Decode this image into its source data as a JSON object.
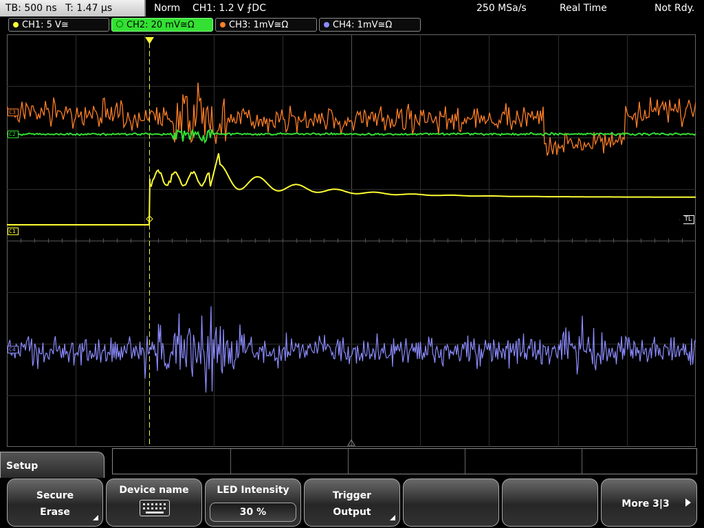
{
  "status": {
    "timebase": "TB: 500 ns",
    "trigger_time": "T: 1.47 µs",
    "mode": "Norm",
    "trigger_source": "CH1: 1.2 V ⨍DC",
    "sample_rate": "250 MSa/s",
    "acq_mode": "Real Time",
    "state": "Not Rdy."
  },
  "channels": [
    {
      "label": "CH1: 5 V≅",
      "color": "#ffff33"
    },
    {
      "label": "CH2: 20 mV≅Ω",
      "color": "#33e033"
    },
    {
      "label": "CH3: 1mV≅Ω",
      "color": "#ff7f27"
    },
    {
      "label": "CH4: 1mV≅Ω",
      "color": "#8c8cff"
    }
  ],
  "markers": {
    "c1": "C1",
    "c2": "C2",
    "c3": "C3",
    "c4": "C4",
    "trigger_level": "TL"
  },
  "menu": {
    "title": "Setup",
    "softkeys": {
      "secure_erase": {
        "line1": "Secure",
        "line2": "Erase"
      },
      "device_name": {
        "label": "Device name",
        "icon": "keyboard-icon"
      },
      "led_intensity": {
        "label": "LED Intensity",
        "value": "30 %"
      },
      "trigger_output": {
        "line1": "Trigger",
        "line2": "Output"
      },
      "empty1": "",
      "empty2": "",
      "more": {
        "label": "More 3|3",
        "icon": "arrow-right-icon"
      }
    }
  }
}
